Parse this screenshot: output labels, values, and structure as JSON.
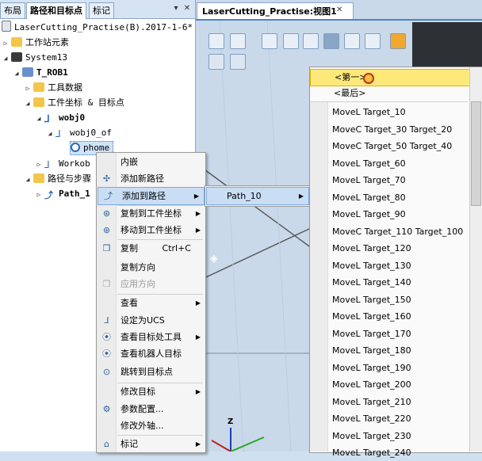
{
  "tabs": {
    "layout": "布局",
    "paths_targets": "路径和目标点",
    "tags": "标记"
  },
  "tree": {
    "station": "LaserCutting_Practise(B).2017-1-6*",
    "station_elements": "工作站元素",
    "system": "System13",
    "robot": "T_ROB1",
    "tool_data": "工具数据",
    "wobj_targets": "工件坐标 & 目标点",
    "wobj0": "wobj0",
    "wobj0_of": "wobj0_of",
    "target": "phome",
    "workobj": "Workob",
    "paths_procedures": "路径与步骤",
    "path": "Path_1"
  },
  "view": {
    "tab": "LaserCutting_Practise:视图1"
  },
  "context_menu": {
    "items": [
      "内嵌",
      "添加新路径",
      "添加到路径",
      "复制到工件坐标",
      "移动到工件坐标",
      "复制",
      "复制方向",
      "应用方向",
      "查看",
      "设定为UCS",
      "查看目标处工具",
      "查看机器人目标",
      "跳转到目标点",
      "修改目标",
      "参数配置...",
      "修改外轴...",
      "标记"
    ],
    "copy_shortcut": "Ctrl+C"
  },
  "submenu_path": {
    "label": "Path_10"
  },
  "target_list": {
    "first": "<第一>",
    "last": "<最后>",
    "items": [
      "MoveL Target_10",
      "MoveC Target_30 Target_20",
      "MoveC Target_50 Target_40",
      "MoveL Target_60",
      "MoveL Target_70",
      "MoveL Target_80",
      "MoveL Target_90",
      "MoveC Target_110 Target_100",
      "MoveL Target_120",
      "MoveL Target_130",
      "MoveL Target_140",
      "MoveL Target_150",
      "MoveL Target_160",
      "MoveL Target_170",
      "MoveL Target_180",
      "MoveL Target_190",
      "MoveL Target_200",
      "MoveL Target_210",
      "MoveL Target_220",
      "MoveL Target_230",
      "MoveL Target_240"
    ]
  },
  "axis": {
    "z": "Z"
  },
  "colors": {
    "accent": "#4a86c5",
    "highlight": "#fde87a",
    "menu_hover": "#c9def4"
  }
}
